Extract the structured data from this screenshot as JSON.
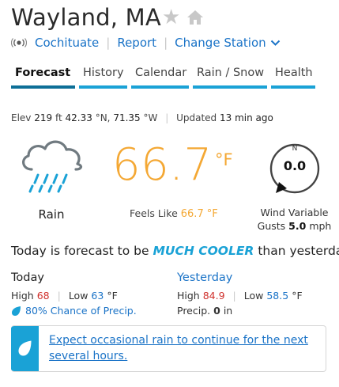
{
  "header": {
    "title": "Wayland, MA",
    "station_links": [
      "Cochituate",
      "Report",
      "Change Station"
    ]
  },
  "tabs": [
    {
      "label": "Forecast",
      "active": true
    },
    {
      "label": "History",
      "active": false
    },
    {
      "label": "Calendar",
      "active": false
    },
    {
      "label": "Rain / Snow",
      "active": false
    },
    {
      "label": "Health",
      "active": false
    }
  ],
  "meta": {
    "elev_label": "Elev",
    "elev_value": "219",
    "elev_unit": "ft",
    "lat": "42.33",
    "lat_unit": "°N,",
    "lon": "71.35",
    "lon_unit": "°W",
    "updated_label": "Updated",
    "updated_value": "13 min ago"
  },
  "current": {
    "condition": "Rain",
    "condition_icon": "rain-cloud-icon",
    "temp": "66.7",
    "temp_unit": "°F",
    "feels_label": "Feels Like",
    "feels_value": "66.7",
    "feels_unit": "°F"
  },
  "wind": {
    "compass_label": "N",
    "speed": "0.0",
    "direction_text": "Wind Variable",
    "gusts_label": "Gusts",
    "gusts_value": "5.0",
    "gusts_unit": "mph"
  },
  "summary": {
    "pre": "Today is forecast to be",
    "emphasis": "MUCH COOLER",
    "post": "than yesterday."
  },
  "today": {
    "title": "Today",
    "high_label": "High",
    "high": "68",
    "low_label": "Low",
    "low": "63",
    "unit": "°F",
    "precip_chance": "80%",
    "precip_text": "Chance of Precip."
  },
  "yesterday": {
    "title": "Yesterday",
    "high_label": "High",
    "high": "84.9",
    "low_label": "Low",
    "low": "58.5",
    "unit": "°F",
    "precip_label": "Precip.",
    "precip_value": "0",
    "precip_unit": "in"
  },
  "alert": {
    "text": "Expect occasional rain to continue for the next several hours."
  },
  "colors": {
    "accent": "#1aa2d6",
    "link": "#1a73c7",
    "temp": "#f4a834",
    "high": "#d0312d",
    "active_tab": "#0d6f97"
  }
}
